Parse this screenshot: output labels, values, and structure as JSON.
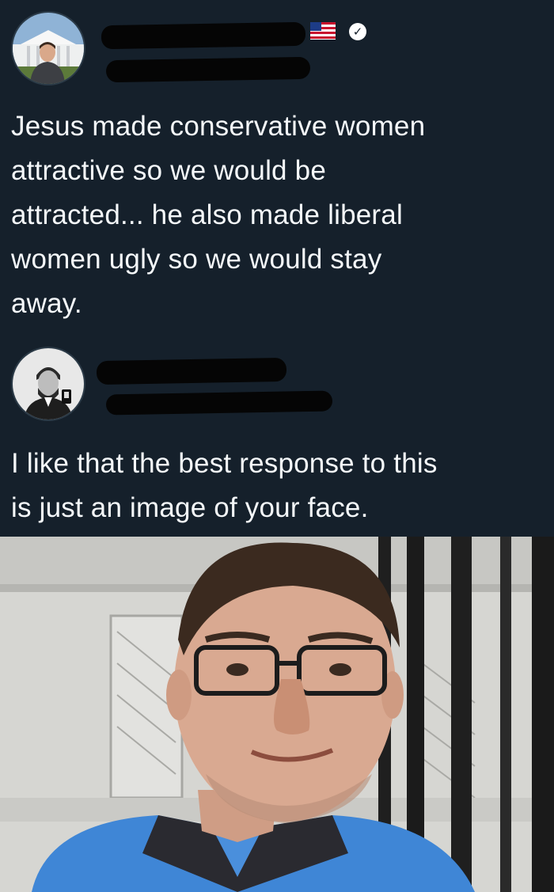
{
  "tweets": [
    {
      "text": "Jesus made conservative women\nattractive so we would be\nattracted... he also made liberal\nwomen ugly so we would stay\naway.",
      "avatar_icon": "profile-photo-man-white-house",
      "has_flag": true,
      "flag_icon": "us-flag-icon",
      "verified": true,
      "verified_icon": "verified-badge-icon"
    },
    {
      "text": "I like that the best response to this\nis just an image of your face.",
      "avatar_icon": "profile-photo-abraham-lincoln-selfie",
      "has_flag": false,
      "verified": false
    }
  ],
  "photo": {
    "icon": "selfie-photo-man-with-glasses",
    "colors": {
      "shirt": "#3f86d6",
      "wall": "#d8d8d4",
      "fence": "#1c1c1c"
    }
  },
  "colors": {
    "background": "#15202b",
    "text": "#f5f8fa",
    "redaction": "#050505"
  }
}
